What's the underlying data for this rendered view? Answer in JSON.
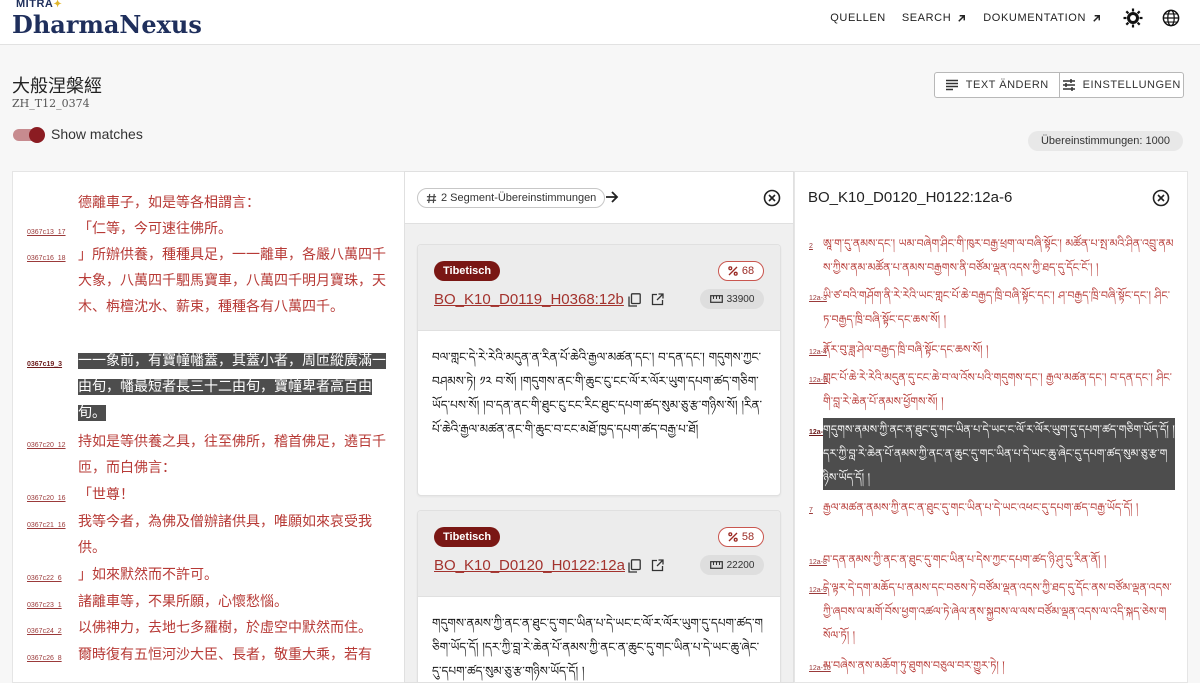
{
  "header": {
    "logo_top": "MITRA",
    "logo_name": "DharmaNexus",
    "nav": [
      {
        "label": "QUELLEN",
        "arrow": false
      },
      {
        "label": "SEARCH",
        "arrow": true
      },
      {
        "label": "DOKUMENTATION",
        "arrow": true
      }
    ]
  },
  "document": {
    "title": "大般涅槃經",
    "id": "ZH_T12_0374"
  },
  "toolbar": {
    "change_text_label": "TEXT ÄNDERN",
    "settings_label": "EINSTELLUNGEN",
    "show_matches_label": "Show matches",
    "show_matches_on": true,
    "match_count_label": "Übereinstimmungen: 1000"
  },
  "left_rows": [
    {
      "ref": "",
      "text": "德離車子，如是等各相謂言：",
      "hl": false
    },
    {
      "ref": "0367c13_17",
      "text": "「仁等，今可速往佛所。",
      "hl": false
    },
    {
      "ref": "0367c16_18",
      "text": "」所辦供養，種種具足，一一離車，各嚴八萬四千大象，八萬四千駟馬寶車，八萬四千明月寶珠，天木、栴檀沈水、薪束，種種各有八萬四千。",
      "hl": false
    },
    {
      "ref": "0367c19_3",
      "text": "一一象前，有寶幢幡蓋，其蓋小者，周匝縱廣滿一由旬，幡最短者長三十二由旬，寶幢卑者高百由旬。",
      "hl": true
    },
    {
      "ref": "0367c20_12",
      "text": "持如是等供養之具，往至佛所，稽首佛足，遶百千匝，而白佛言：",
      "hl": false
    },
    {
      "ref": "0367c20_16",
      "text": "「世尊！",
      "hl": false
    },
    {
      "ref": "0367c21_16",
      "text": "我等今者，為佛及僧辦諸供具，唯願如來哀受我供。",
      "hl": false
    },
    {
      "ref": "0367c22_6",
      "text": "」如來默然而不許可。",
      "hl": false
    },
    {
      "ref": "0367c23_1",
      "text": "諸離車等，不果所願，心懷愁惱。",
      "hl": false
    },
    {
      "ref": "0367c24_2",
      "text": "以佛神力，去地七多羅樹，於虛空中默然而住。",
      "hl": false
    },
    {
      "ref": "0367c26_8",
      "text": "爾時復有五恒河沙大臣、長者，敬重大乘，若有",
      "hl": false
    }
  ],
  "middle": {
    "segment_label": "2 Segment-Übereinstimmungen",
    "cards": [
      {
        "language": "Tibetisch",
        "percent": "68",
        "link": "BO_K10_D0119_H0368:12b",
        "length": "33900",
        "text": "བལ་གླང་དེ་རེ་རེའི་མདུན་ན་རིན་པོ་ཆེའི་རྒྱལ་མཚན་དང་། བ་དན་དང་། གདུགས་ཀྱང་བཤམས་ཏེ། ༡༢ བ་སོ། །གདུགས་ནང་གི་ཆུང་ངུ་ངང་ལོ་ར་ལོར་ཡུག་དཔག་ཚད་གཅིག་ཡོད་པས་སོ། །བ་དན་ནང་གི་ཐུང་ངུ་ངང་རིང་ཐུང་དཔག་ཚད་སུམ་ཅུ་རྩ་གཉིས་སོ། །རིན་པོ་ཆེའི་རྒྱལ་མཚན་ནང་གི་ཆུང་བ་ངང་མཐོ་ཁྱད་དཔག་ཚད་བརྒྱ་པ་ཐོ།"
      },
      {
        "language": "Tibetisch",
        "percent": "58",
        "link": "BO_K10_D0120_H0122:12a",
        "length": "22200",
        "text": "གདུགས་ནམས་ཀྱི་ནང་ན་ཐུང་དུ་གང་ཡིན་པ་དེ་ཡང་ང་ལོ་ར་ལོར་ཡུག་དུ་དཔག་ཚད་གཅིག་ཡོད་དོ། །དར་ཀྱི་བླ་རེ་ཆེན་པོ་ནམས་ཀྱི་ནང་ན་ཆུང་དུ་གང་ཡིན་པ་དེ་ཡང་ཆུ་ཞེང་དུ་དཔག་ཚད་སུམ་ཅུ་རྩ་གཉིས་ཡོད་དོ། །"
      }
    ]
  },
  "right": {
    "title": "BO_K10_D0120_H0122:12a-6",
    "rows": [
      {
        "ref": "2",
        "text": "ཨཱ་ག་དུ་ནམས་དང་། ཡམ་བཞེག་ཤིང་གི་ཁུར་བརྒྱ་ཕྲག་ལ་བཞི་སྟོང་། མཚོན་པ་སྤ་མའི་ཤིན་འབྲུ་ནམས་ཀྱིས་ནམ་མཚོན་པ་ནམས་བརྒྱགས་ནི་བཙོམ་ལྡན་འདས་ཀྱི་ཐད་དུ་དོང་ངོ་། །",
        "hl": false
      },
      {
        "ref": "12a-3",
        "text": "ཡི་ཙ་བའི་གཤོག་ནི་རེ་རེའི་ཡང་གླང་པོ་ཆེ་བརྒྱད་ཁྲི་བཞི་སྟོང་དང་། ཤ་བརྒྱད་ཁྲི་བཞི་སྟོང་དང་། ཤིང་ཏ་བརྒྱད་ཁྲི་བཞི་སྟོང་དང་ཆས་སོ། །",
        "hl": false
      },
      {
        "ref": "12a-4",
        "text": "ནོར་བུ་ཟླ་ཤེལ་བརྒྱད་ཁྲི་བཞི་སྟོང་དང་ཆས་སོ། །",
        "hl": false
      },
      {
        "ref": "12a-5",
        "text": "གླང་པོ་ཆེ་རེ་རེའི་མདུན་དུ་ངང་ཆེ་བ་ལ་འོས་པའི་གདུགས་དང་། རྒྱལ་མཚན་དང་། བ་དན་དང་། ཤིང་གི་བླ་རེ་ཆེན་པོ་ནམས་ཕྱོགས་སོ། །",
        "hl": false
      },
      {
        "ref": "12a-6",
        "text": "གདུགས་ནམས་ཀྱི་ནང་ན་ཐུང་དུ་གང་ཡིན་པ་དེ་ཡང་ང་ལོ་ར་ལོར་ཡུག་དུ་དཔག་ཚད་གཅིག་ཡོད་དོ། །དར་ཀྱི་བླ་རེ་ཆེན་པོ་ནམས་ཀྱི་ནང་ན་ཆུང་དུ་གང་ཡིན་པ་དེ་ཡང་ཆུ་ཞེང་དུ་དཔག་ཚད་སུམ་ཅུ་རྩ་གཉིས་ཡོད་དོ། །",
        "hl": true
      },
      {
        "ref": "7",
        "text": "རྒྱལ་མཚན་ནམས་ཀྱི་ནང་ན་ཐུང་དུ་གང་ཡིན་པ་དེ་ཡང་འཕང་དུ་དཔག་ཚད་བརྒྱ་ཡོད་དོ། །",
        "hl": false
      },
      {
        "ref": "12a-8",
        "text": "བ་དན་ནམས་ཀྱི་ནང་ན་ཐུང་དུ་གང་ཡིན་པ་དེས་ཀྱང་དཔག་ཚད་ཉི་ཤུ་དུ་རིན་ནོ། །",
        "hl": false
      },
      {
        "ref": "12a-9",
        "text": "དེ་ལྟར་དེ་དག་མཆོད་པ་ནམས་དང་བཅས་ཏེ་བཙོམ་ལྡན་འདས་ཀྱི་ཐད་དུ་དོང་ནས་བཙོམ་ལྡན་འདས་ཀྱི་ཞབས་ལ་མགོ་བོས་ཕྱག་འཚལ་ཏེ་ཞེལ་ནས་སྐྱབས་ལ་ལས་བཙོམ་ལྡན་འདས་ལ་འདི་སྐད་ཅེས་གསོལ་ཏོ། །",
        "hl": false
      },
      {
        "ref": "12a-10",
        "text": "མ་བཞེས་ནས་མཆོག་ཏུ་ཐུགས་བཅུལ་བར་གྱུར་ཏེ། །",
        "hl": false
      }
    ]
  }
}
